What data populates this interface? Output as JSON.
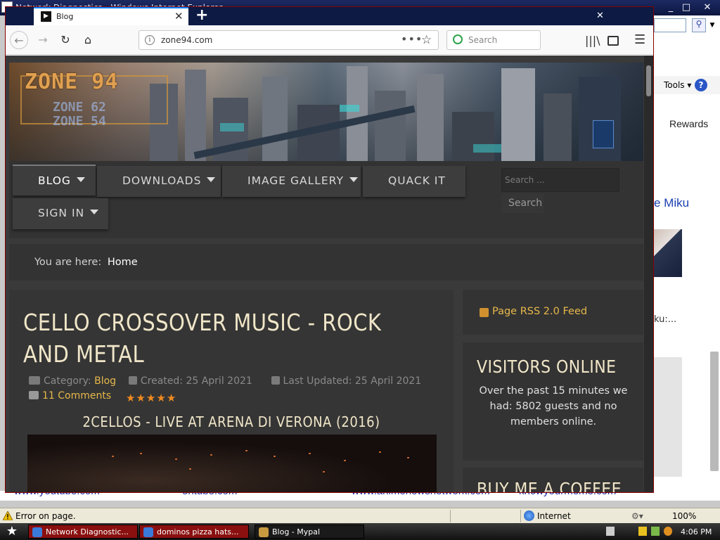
{
  "background_window": {
    "title": "Network Diagnostics - Windows Internet Explorer",
    "tools_label": "Tools",
    "rewards_label": "Rewards",
    "miku_text": "e Miku",
    "ku_text": "ku:...",
    "links": [
      "www.youtube.com",
      "ontube.com",
      "www.animenewsnetwork.com",
      "knowyourmeme.com"
    ],
    "status_error": "Error on page.",
    "status_zone": "Internet",
    "status_zoom": "100%"
  },
  "taskbar": {
    "tasks": [
      {
        "label": "Network Diagnostic...",
        "icon": "ie-icon"
      },
      {
        "label": "dominos pizza hats...",
        "icon": "ie-icon"
      },
      {
        "label": "Blog - Mypal",
        "icon": "mypal-icon"
      }
    ],
    "clock": "4:06 PM"
  },
  "browser": {
    "tab_title": "Blog",
    "url": "zone94.com",
    "search_placeholder": "Search"
  },
  "site": {
    "logo_main": "ZONE 94",
    "logo_sub1": "ZONE 62",
    "logo_sub2": "ZONE 54",
    "menu": [
      {
        "label": "BLOG",
        "has_caret": true
      },
      {
        "label": "DOWNLOADS",
        "has_caret": true
      },
      {
        "label": "IMAGE GALLERY",
        "has_caret": true
      },
      {
        "label": "QUACK IT",
        "has_caret": false
      },
      {
        "label": "SIGN IN",
        "has_caret": true
      }
    ],
    "search_placeholder": "Search ...",
    "search_button": "Search",
    "breadcrumb_prefix": "You are here:",
    "breadcrumb_home": "Home",
    "article": {
      "title": "CELLO CROSSOVER MUSIC - ROCK AND METAL",
      "category_label": "Category:",
      "category": "Blog",
      "created": "Created: 25 April 2021",
      "updated": "Last Updated: 25 April 2021",
      "comments": "11 Comments",
      "rating": 5,
      "rating_max": 5,
      "video_title": "2CELLOS - LIVE AT ARENA DI VERONA (2016)"
    },
    "sidebar": {
      "rss": "Page RSS 2.0 Feed",
      "visitors_title": "VISITORS ONLINE",
      "visitors_text": "Over the past 15 minutes we had: 5802 guests and no members online.",
      "coffee_title": "BUY ME A COFFEE"
    }
  }
}
